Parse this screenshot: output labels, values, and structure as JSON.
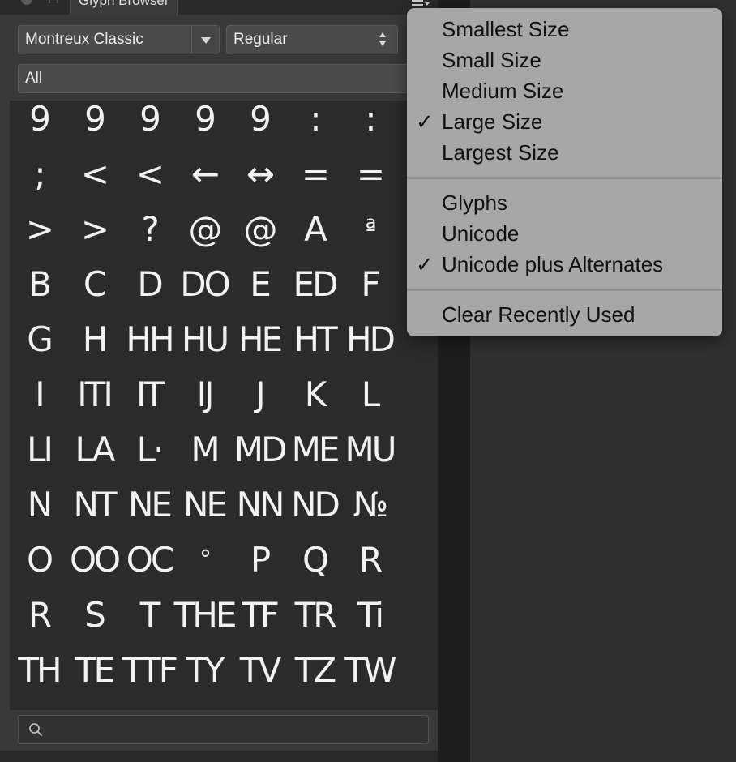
{
  "panel": {
    "tab_title": "Glyph Browser",
    "font_family": "Montreux Classic",
    "font_style": "Regular",
    "category": "All",
    "search_placeholder": ""
  },
  "glyph_rows": [
    [
      "9",
      "9",
      "9",
      "9",
      "9",
      ":",
      ":"
    ],
    [
      ";",
      "<",
      "<",
      "←",
      "↔",
      "=",
      "="
    ],
    [
      ">",
      ">",
      "?",
      "@",
      "@",
      "A",
      "ª"
    ],
    [
      "B",
      "C",
      "D",
      "DO",
      "E",
      "ED",
      "F"
    ],
    [
      "G",
      "H",
      "HH",
      "HU",
      "HE",
      "HT",
      "HD"
    ],
    [
      "I",
      "ITI",
      "IT",
      "IJ",
      "J",
      "K",
      "L"
    ],
    [
      "LI",
      "LA",
      "L·",
      "M",
      "MD",
      "ME",
      "MU"
    ],
    [
      "N",
      "NT",
      "NE",
      "NE",
      "NN",
      "ND",
      "№"
    ],
    [
      "O",
      "OO",
      "OC",
      "°",
      "P",
      "Q",
      "R"
    ],
    [
      "R",
      "S",
      "T",
      "THE",
      "TF",
      "TR",
      "Ti"
    ],
    [
      "TH",
      "TE",
      "TTF",
      "TY",
      "TV",
      "TZ",
      "TW"
    ]
  ],
  "menu": {
    "items": [
      {
        "label": "Smallest Size",
        "checked": false
      },
      {
        "label": "Small Size",
        "checked": false
      },
      {
        "label": "Medium Size",
        "checked": false
      },
      {
        "label": "Large Size",
        "checked": true
      },
      {
        "label": "Largest Size",
        "checked": false
      },
      {
        "label": "Glyphs",
        "checked": false
      },
      {
        "label": "Unicode",
        "checked": false
      },
      {
        "label": "Unicode plus Alternates",
        "checked": true
      },
      {
        "label": "Clear Recently Used",
        "checked": false
      }
    ],
    "check_glyph": "✓"
  },
  "icons": {
    "tab_close": "close-icon",
    "panel_menu": "panel-menu-icon",
    "search": "search-icon",
    "dropdown": "chevron-down-icon"
  }
}
